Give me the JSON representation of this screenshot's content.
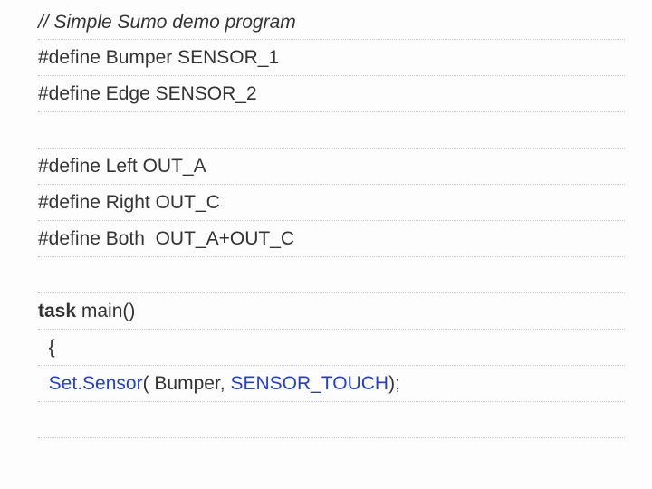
{
  "lines": {
    "comment": "// Simple Sumo demo program",
    "def_bumper": "#define Bumper SENSOR_1",
    "def_edge": "#define Edge SENSOR_2",
    "def_left": "#define Left OUT_A",
    "def_right": "#define Right OUT_C",
    "def_both": "#define Both  OUT_A+OUT_C",
    "task": "task",
    "main": " main()",
    "brace": "  {",
    "setsensor": "  Set.Sensor",
    "args_a": "( Bumper, ",
    "args_b": "SENSOR_TOUCH",
    "args_c": ");"
  }
}
